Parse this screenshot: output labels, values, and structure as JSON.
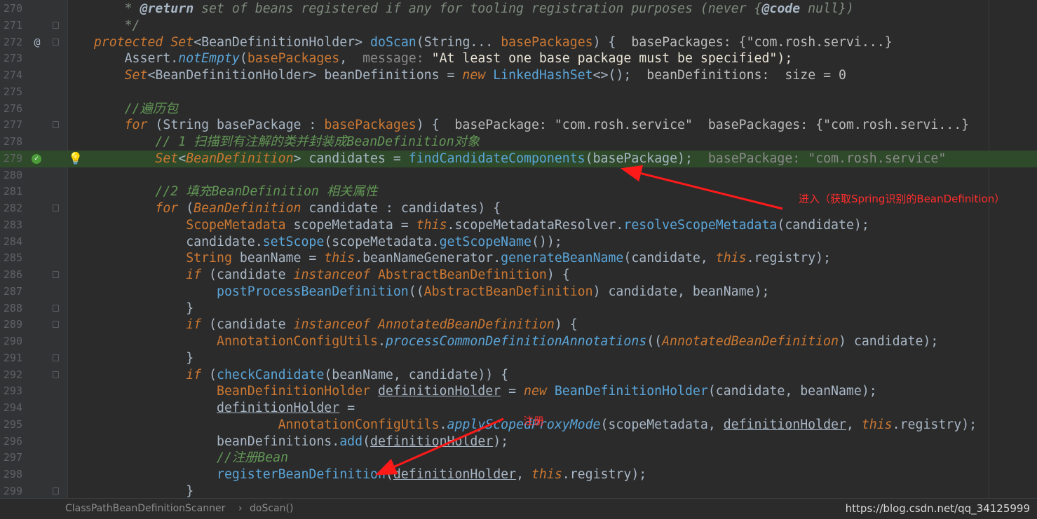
{
  "lines": [
    {
      "num": "270",
      "segments": [
        {
          "t": "        * ",
          "c": "dc"
        },
        {
          "t": "@return",
          "c": "dtag"
        },
        {
          "t": " set of beans registered if any for tooling registration purposes (never {",
          "c": "dc"
        },
        {
          "t": "@code",
          "c": "dtag"
        },
        {
          "t": " null})",
          "c": "dc"
        }
      ]
    },
    {
      "num": "271",
      "segments": [
        {
          "t": "        */",
          "c": "dc"
        }
      ]
    },
    {
      "num": "272",
      "segments": [
        {
          "t": "    "
        },
        {
          "t": "protected",
          "c": "kw"
        },
        {
          "t": " "
        },
        {
          "t": "Set",
          "c": "ity"
        },
        {
          "t": "<BeanDefinitionHolder> "
        },
        {
          "t": "doScan",
          "c": "fn"
        },
        {
          "t": "(String... "
        },
        {
          "t": "basePackages",
          "c": "ty"
        },
        {
          "t": ") {  "
        },
        {
          "t": "basePackages: {\"com.rosh.servi...}",
          "c": "hint"
        }
      ]
    },
    {
      "num": "273",
      "segments": [
        {
          "t": "        Assert."
        },
        {
          "t": "notEmpty",
          "c": "ifn"
        },
        {
          "t": "("
        },
        {
          "t": "basePackages",
          "c": "ty"
        },
        {
          "t": ",  "
        },
        {
          "t": "message:",
          "c": "hintdim"
        },
        {
          "t": " \"At least one base package must be specified\");",
          "c": "str"
        }
      ]
    },
    {
      "num": "274",
      "segments": [
        {
          "t": "        "
        },
        {
          "t": "Set",
          "c": "ity"
        },
        {
          "t": "<BeanDefinitionHolder> beanDefinitions = "
        },
        {
          "t": "new",
          "c": "kw"
        },
        {
          "t": " "
        },
        {
          "t": "LinkedHashSet",
          "c": "fn"
        },
        {
          "t": "<>();  "
        },
        {
          "t": "beanDefinitions:  size = 0",
          "c": "hint"
        }
      ]
    },
    {
      "num": "275",
      "segments": [
        {
          "t": ""
        }
      ]
    },
    {
      "num": "276",
      "segments": [
        {
          "t": "        "
        },
        {
          "t": "//遍历包",
          "c": "cm"
        }
      ]
    },
    {
      "num": "277",
      "segments": [
        {
          "t": "        "
        },
        {
          "t": "for",
          "c": "kw"
        },
        {
          "t": " (String basePackage : "
        },
        {
          "t": "basePackages",
          "c": "ty"
        },
        {
          "t": ") {  "
        },
        {
          "t": "basePackage: \"com.rosh.service\"  basePackages: {\"com.rosh.servi...}",
          "c": "hint"
        }
      ]
    },
    {
      "num": "278",
      "segments": [
        {
          "t": "            "
        },
        {
          "t": "// 1 扫描到有注解的类并封装成BeanDefinition对象",
          "c": "cm"
        }
      ]
    },
    {
      "num": "279",
      "current": true,
      "segments": [
        {
          "t": "            "
        },
        {
          "t": "Set",
          "c": "ity"
        },
        {
          "t": "<"
        },
        {
          "t": "BeanDefinition",
          "c": "ity"
        },
        {
          "t": "> candidates = "
        },
        {
          "t": "findCandidateComponents",
          "c": "fn"
        },
        {
          "t": "(basePackage);  "
        },
        {
          "t": "basePackage: \"com.rosh.service\"",
          "c": "hintdim"
        }
      ]
    },
    {
      "num": "280",
      "segments": [
        {
          "t": ""
        }
      ]
    },
    {
      "num": "281",
      "segments": [
        {
          "t": "            "
        },
        {
          "t": "//2 填充BeanDefinition 相关属性",
          "c": "cm"
        }
      ]
    },
    {
      "num": "282",
      "segments": [
        {
          "t": "            "
        },
        {
          "t": "for",
          "c": "kw"
        },
        {
          "t": " ("
        },
        {
          "t": "BeanDefinition",
          "c": "ity"
        },
        {
          "t": " candidate : candidates) {"
        }
      ]
    },
    {
      "num": "283",
      "segments": [
        {
          "t": "                "
        },
        {
          "t": "ScopeMetadata",
          "c": "ty"
        },
        {
          "t": " scopeMetadata = "
        },
        {
          "t": "this",
          "c": "kw"
        },
        {
          "t": ".scopeMetadataResolver."
        },
        {
          "t": "resolveScopeMetadata",
          "c": "fn"
        },
        {
          "t": "(candidate);"
        }
      ]
    },
    {
      "num": "284",
      "segments": [
        {
          "t": "                candidate."
        },
        {
          "t": "setScope",
          "c": "fn"
        },
        {
          "t": "(scopeMetadata."
        },
        {
          "t": "getScopeName",
          "c": "fn"
        },
        {
          "t": "());"
        }
      ]
    },
    {
      "num": "285",
      "segments": [
        {
          "t": "                "
        },
        {
          "t": "String",
          "c": "ty"
        },
        {
          "t": " beanName = "
        },
        {
          "t": "this",
          "c": "kw"
        },
        {
          "t": ".beanNameGenerator."
        },
        {
          "t": "generateBeanName",
          "c": "fn"
        },
        {
          "t": "(candidate, "
        },
        {
          "t": "this",
          "c": "kw"
        },
        {
          "t": ".registry);"
        }
      ]
    },
    {
      "num": "286",
      "segments": [
        {
          "t": "                "
        },
        {
          "t": "if",
          "c": "kw"
        },
        {
          "t": " (candidate "
        },
        {
          "t": "instanceof",
          "c": "kw"
        },
        {
          "t": " "
        },
        {
          "t": "AbstractBeanDefinition",
          "c": "ty"
        },
        {
          "t": ") {"
        }
      ]
    },
    {
      "num": "287",
      "segments": [
        {
          "t": "                    "
        },
        {
          "t": "postProcessBeanDefinition",
          "c": "fn"
        },
        {
          "t": "(("
        },
        {
          "t": "AbstractBeanDefinition",
          "c": "ty"
        },
        {
          "t": ") candidate, beanName);"
        }
      ]
    },
    {
      "num": "288",
      "segments": [
        {
          "t": "                }"
        }
      ]
    },
    {
      "num": "289",
      "segments": [
        {
          "t": "                "
        },
        {
          "t": "if",
          "c": "kw"
        },
        {
          "t": " (candidate "
        },
        {
          "t": "instanceof",
          "c": "kw"
        },
        {
          "t": " "
        },
        {
          "t": "AnnotatedBeanDefinition",
          "c": "ity"
        },
        {
          "t": ") {"
        }
      ]
    },
    {
      "num": "290",
      "segments": [
        {
          "t": "                    "
        },
        {
          "t": "AnnotationConfigUtils",
          "c": "ty"
        },
        {
          "t": "."
        },
        {
          "t": "processCommonDefinitionAnnotations",
          "c": "ifn"
        },
        {
          "t": "(("
        },
        {
          "t": "AnnotatedBeanDefinition",
          "c": "ity"
        },
        {
          "t": ") candidate);"
        }
      ]
    },
    {
      "num": "291",
      "segments": [
        {
          "t": "                }"
        }
      ]
    },
    {
      "num": "292",
      "segments": [
        {
          "t": "                "
        },
        {
          "t": "if",
          "c": "kw"
        },
        {
          "t": " ("
        },
        {
          "t": "checkCandidate",
          "c": "fn"
        },
        {
          "t": "(beanName, candidate)) {"
        }
      ]
    },
    {
      "num": "293",
      "segments": [
        {
          "t": "                    "
        },
        {
          "t": "BeanDefinitionHolder",
          "c": "ty"
        },
        {
          "t": " "
        },
        {
          "t": "definitionHolder",
          "c": "ul"
        },
        {
          "t": " = "
        },
        {
          "t": "new",
          "c": "kw"
        },
        {
          "t": " "
        },
        {
          "t": "BeanDefinitionHolder",
          "c": "fn"
        },
        {
          "t": "(candidate, beanName);"
        }
      ]
    },
    {
      "num": "294",
      "segments": [
        {
          "t": "                    "
        },
        {
          "t": "definitionHolder",
          "c": "ul"
        },
        {
          "t": " ="
        }
      ]
    },
    {
      "num": "295",
      "segments": [
        {
          "t": "                            "
        },
        {
          "t": "AnnotationConfigUtils",
          "c": "ty"
        },
        {
          "t": "."
        },
        {
          "t": "applyScopedProxyMode",
          "c": "ifn"
        },
        {
          "t": "(scopeMetadata, "
        },
        {
          "t": "definitionHolder",
          "c": "ul"
        },
        {
          "t": ", "
        },
        {
          "t": "this",
          "c": "kw"
        },
        {
          "t": ".registry);"
        }
      ]
    },
    {
      "num": "296",
      "segments": [
        {
          "t": "                    beanDefinitions."
        },
        {
          "t": "add",
          "c": "fn"
        },
        {
          "t": "("
        },
        {
          "t": "definitionHolder",
          "c": "ul"
        },
        {
          "t": ");"
        }
      ]
    },
    {
      "num": "297",
      "segments": [
        {
          "t": "                    "
        },
        {
          "t": "//注册Bean",
          "c": "cm"
        }
      ]
    },
    {
      "num": "298",
      "segments": [
        {
          "t": "                    "
        },
        {
          "t": "registerBeanDefinition",
          "c": "fn"
        },
        {
          "t": "("
        },
        {
          "t": "definitionHolder",
          "c": "ul"
        },
        {
          "t": ", "
        },
        {
          "t": "this",
          "c": "kw"
        },
        {
          "t": ".registry);"
        }
      ]
    },
    {
      "num": "299",
      "segments": [
        {
          "t": "                }"
        }
      ]
    }
  ],
  "annotations": {
    "enter": "进入（获取Spring识别的BeanDefinition）",
    "register": "注册"
  },
  "breadcrumb": [
    "ClassPathBeanDefinitionScanner",
    "doScan()"
  ],
  "breadcrumb_sep": "›",
  "watermark": "https://blog.csdn.net/qq_34125999",
  "gutter_marks": {
    "272": "@",
    "279": "✓"
  },
  "colors": {
    "current_line": "#2f4a2a",
    "arrow": "#ff1a1a"
  }
}
